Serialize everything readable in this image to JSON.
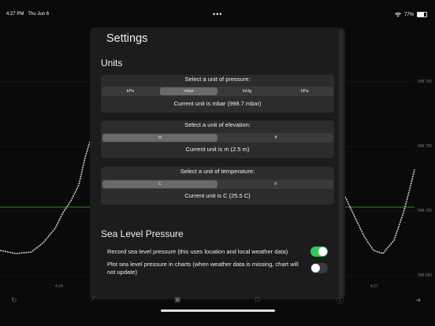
{
  "status": {
    "time": "4:27 PM",
    "date": "Thu Jun 6",
    "dots": "•••",
    "battery_text": "77%",
    "battery_level": 0.77,
    "wifi_icon": "wifi-icon",
    "battery_icon": "battery-icon"
  },
  "chart": {
    "y_labels": [
      "998.760",
      "998.730",
      "998.700",
      "998.680"
    ],
    "x_labels": [
      "4:24",
      "4:27"
    ],
    "line_color": "#cfcfcf",
    "reference_color": "#2e8b2e"
  },
  "settings": {
    "title": "Settings",
    "units_title": "Units",
    "pressure": {
      "label": "Select a unit of pressure:",
      "options": [
        "kPa",
        "mbar",
        "inHg",
        "hPa"
      ],
      "selected": 1,
      "current": "Current unit is mbar (998.7 mbar)"
    },
    "elevation": {
      "label": "Select a unit of elevation:",
      "options": [
        "m",
        "ft"
      ],
      "selected": 0,
      "current": "Current unit is m (2.5 m)"
    },
    "temperature": {
      "label": "Select a unit of temperature:",
      "options": [
        "C",
        "F"
      ],
      "selected": 0,
      "current": "Current unit is C (25.5 C)"
    },
    "slp_title": "Sea Level Pressure",
    "record_slp": {
      "label": "Record sea level pressure (this uses location and local weather data)",
      "on": true
    },
    "plot_slp": {
      "label": "Plot sea level pressure in charts (when weather data is missing, chart will not update)",
      "on": false
    },
    "toggle_on_color": "#34c759",
    "toggle_off_color": "#3a3a3c"
  },
  "tabbar": {
    "icons": [
      "refresh-icon",
      "edit-icon",
      "calendar-icon",
      "calendar-alt-icon",
      "info-icon",
      "arrow-right-icon"
    ]
  }
}
